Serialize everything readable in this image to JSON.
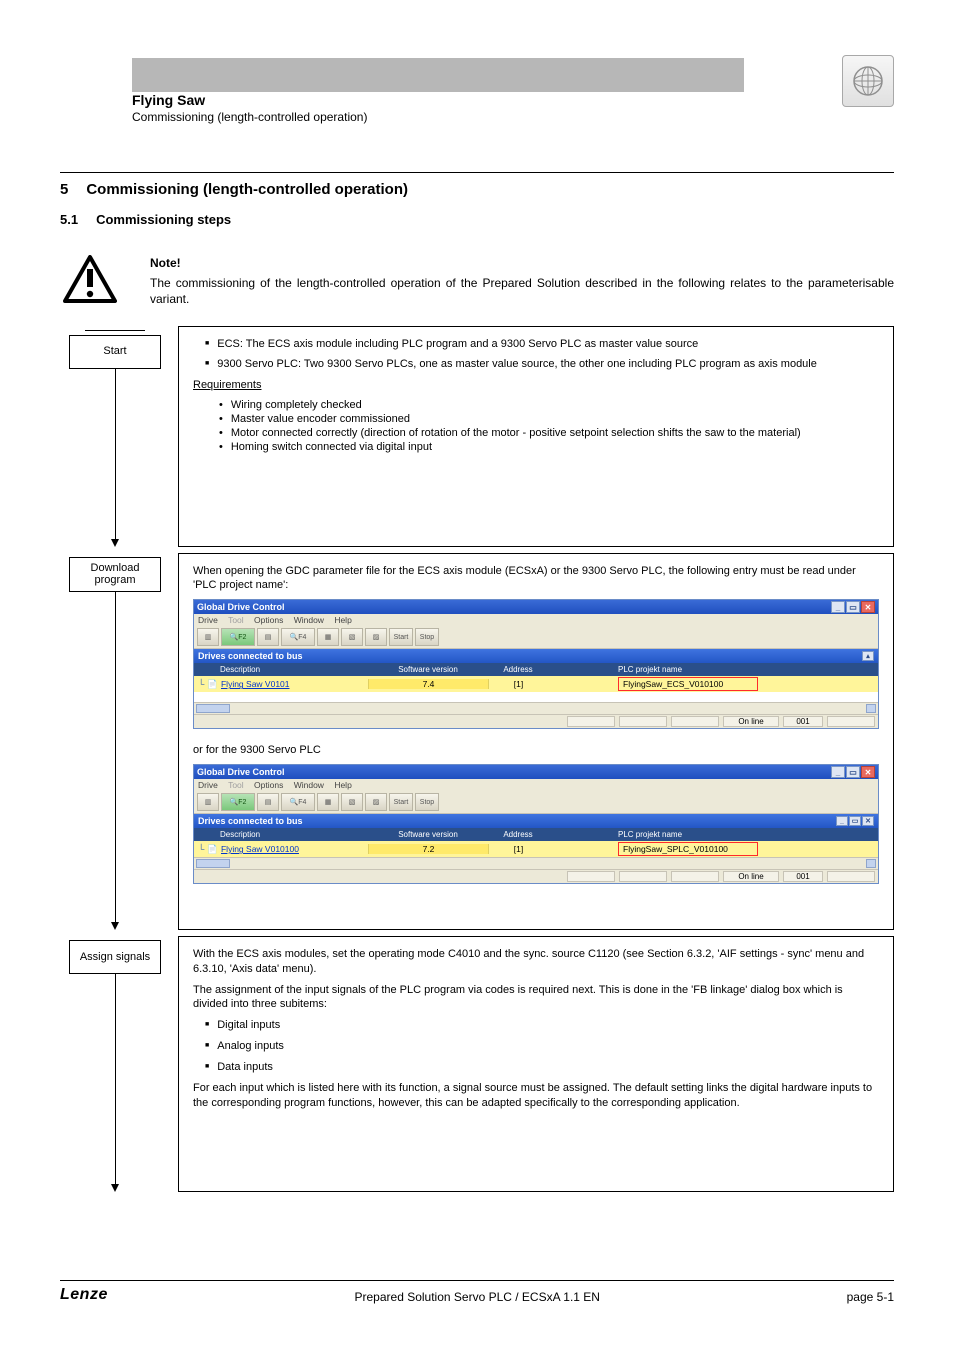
{
  "header": {
    "title": "Flying Saw",
    "subtitle": "Commissioning (length-controlled operation)"
  },
  "section": {
    "number": "5",
    "title": "Commissioning (length-controlled operation)",
    "sub_number": "5.1",
    "sub_title": "Commissioning steps"
  },
  "note": {
    "title": "Note!",
    "body": "The commissioning of the length-controlled operation of the Prepared Solution described in the following relates to the parameterisable variant."
  },
  "flow": {
    "start": "Start",
    "step1": "Download program",
    "step2": "Assign signals"
  },
  "start_block": {
    "b1": "ECS: The ECS axis module including PLC program and a 9300 Servo PLC as master value source",
    "b2": "9300 Servo PLC: Two 9300 Servo PLCs, one as master value source, the other one including PLC program as axis module",
    "req_label": "Requirements",
    "r1": "Wiring completely checked",
    "r2": "Master value encoder commissioned",
    "r3": "Motor connected correctly (direction of rotation of the motor - positive setpoint selection shifts the saw to the material)",
    "r4": "Homing switch connected via digital input"
  },
  "download_block": {
    "intro": "When opening the GDC parameter file for the ECS axis module (ECSxA) or the 9300 Servo PLC, the following entry must be read under 'PLC project name':"
  },
  "gdc": {
    "win_title": "Global Drive Control",
    "menu": {
      "drive": "Drive",
      "tool": "Tool",
      "options": "Options",
      "window": "Window",
      "help": "Help"
    },
    "sub_title": "Drives connected to bus",
    "cols": {
      "desc": "Description",
      "soft": "Software version",
      "addr": "Address",
      "plc": "PLC projekt name"
    },
    "ecs": {
      "desc": "Flying Saw V0101",
      "soft": "7.4",
      "addr": "[1]",
      "plc": "FlyingSaw_ECS_V010100"
    },
    "splc": {
      "desc": "Flying Saw V010100",
      "soft": "7.2",
      "addr": "[1]",
      "plc": "FlyingSaw_SPLC_V010100"
    },
    "status": {
      "online": "On line",
      "code": "001"
    },
    "mid_text": "or for the 9300 Servo PLC"
  },
  "assign_block": {
    "p1": "With the ECS axis modules, set the operating mode C4010 and the sync. source C1120 (see Section 6.3.2, 'AIF settings - sync' menu and 6.3.10, 'Axis data' menu).",
    "p2": "The assignment of the input signals of the PLC program via codes is required next. This is done in the 'FB linkage' dialog box which is divided into three subitems:",
    "li1": "Digital inputs",
    "li2": "Analog inputs",
    "li3": "Data inputs",
    "p3": "For each input which is listed here with its function, a signal source must be assigned. The default setting links the digital hardware inputs to the corresponding program functions, however, this can be adapted specifically to the corresponding application."
  },
  "footer": {
    "brand": "Lenze",
    "center": "Prepared Solution Servo PLC / ECSxA 1.1 EN",
    "page": "page 5-1"
  }
}
